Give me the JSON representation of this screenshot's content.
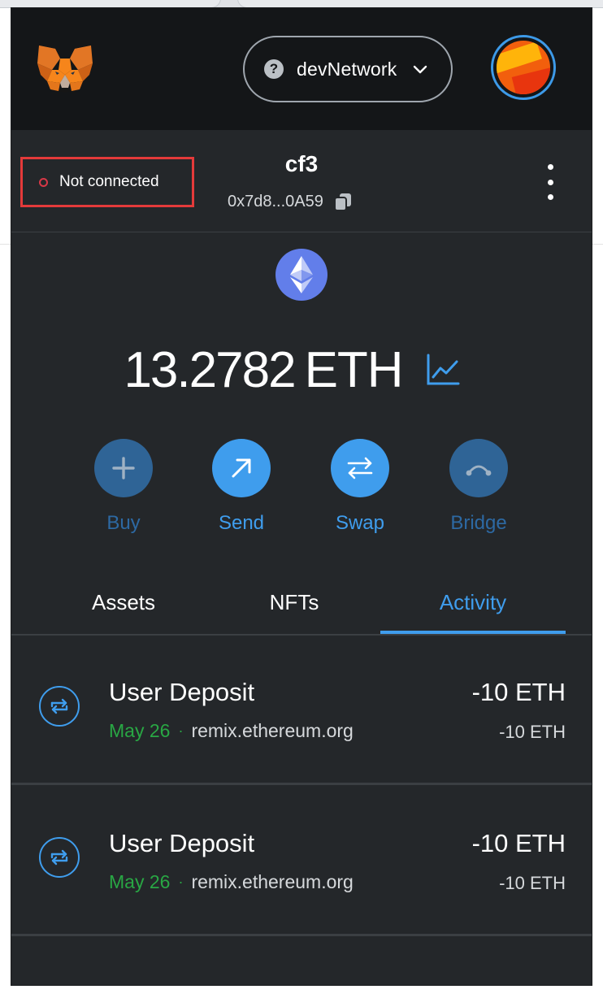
{
  "header": {
    "network_name": "devNetwork",
    "network_icon_glyph": "?",
    "network_icon": "question-icon",
    "logo": "metamask-fox-icon",
    "avatar": "account-avatar"
  },
  "account": {
    "connection_status": "Not connected",
    "name": "cf3",
    "address_short": "0x7d8...0A59"
  },
  "balance": {
    "value": "13.2782",
    "unit": "ETH"
  },
  "actions": [
    {
      "label": "Buy",
      "icon": "plus-icon",
      "enabled": false
    },
    {
      "label": "Send",
      "icon": "arrow-up-right-icon",
      "enabled": true
    },
    {
      "label": "Swap",
      "icon": "swap-arrows-icon",
      "enabled": true
    },
    {
      "label": "Bridge",
      "icon": "bridge-icon",
      "enabled": false
    }
  ],
  "tabs": [
    {
      "label": "Assets",
      "active": false
    },
    {
      "label": "NFTs",
      "active": false
    },
    {
      "label": "Activity",
      "active": true
    }
  ],
  "activity": [
    {
      "title": "User Deposit",
      "date": "May 26",
      "separator": "·",
      "origin": "remix.ethereum.org",
      "amount": "-10 ETH",
      "amount_secondary": "-10 ETH"
    },
    {
      "title": "User Deposit",
      "date": "May 26",
      "separator": "·",
      "origin": "remix.ethereum.org",
      "amount": "-10 ETH",
      "amount_secondary": "-10 ETH"
    }
  ],
  "colors": {
    "accent": "#3f9ded",
    "status_disconnected": "#d73847",
    "date_green": "#29a744",
    "popup_bg": "#24272a",
    "header_bg": "#141618"
  }
}
